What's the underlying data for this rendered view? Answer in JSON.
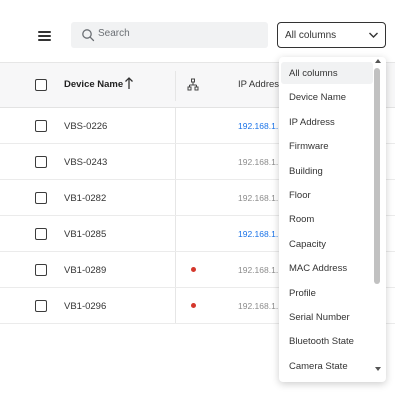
{
  "search": {
    "placeholder": "Search"
  },
  "column_select": {
    "value": "All columns"
  },
  "table": {
    "headers": {
      "device_name": "Device Name",
      "ip": "IP Address"
    },
    "rows": [
      {
        "name": "VBS-0226",
        "ip": "192.168.1.",
        "ip_color": "#1a73e8",
        "dot": false
      },
      {
        "name": "VBS-0243",
        "ip": "192.168.1.",
        "ip_color": "#8c8c8c",
        "dot": false
      },
      {
        "name": "VB1-0282",
        "ip": "192.168.1.",
        "ip_color": "#8c8c8c",
        "dot": false
      },
      {
        "name": "VB1-0285",
        "ip": "192.168.1.",
        "ip_color": "#1a73e8",
        "dot": false
      },
      {
        "name": "VB1-0289",
        "ip": "192.168.1.",
        "ip_color": "#8c8c8c",
        "dot": true
      },
      {
        "name": "VB1-0296",
        "ip": "192.168.1.",
        "ip_color": "#8c8c8c",
        "dot": true
      }
    ]
  },
  "dropdown": {
    "options": [
      "All columns",
      "Device Name",
      "IP Address",
      "Firmware",
      "Building",
      "Floor",
      "Room",
      "Capacity",
      "MAC Address",
      "Profile",
      "Serial Number",
      "Bluetooth State",
      "Camera State"
    ],
    "selected": "All columns"
  },
  "colors": {
    "accent_link": "#1a73e8",
    "status_dot": "#d4372c"
  }
}
